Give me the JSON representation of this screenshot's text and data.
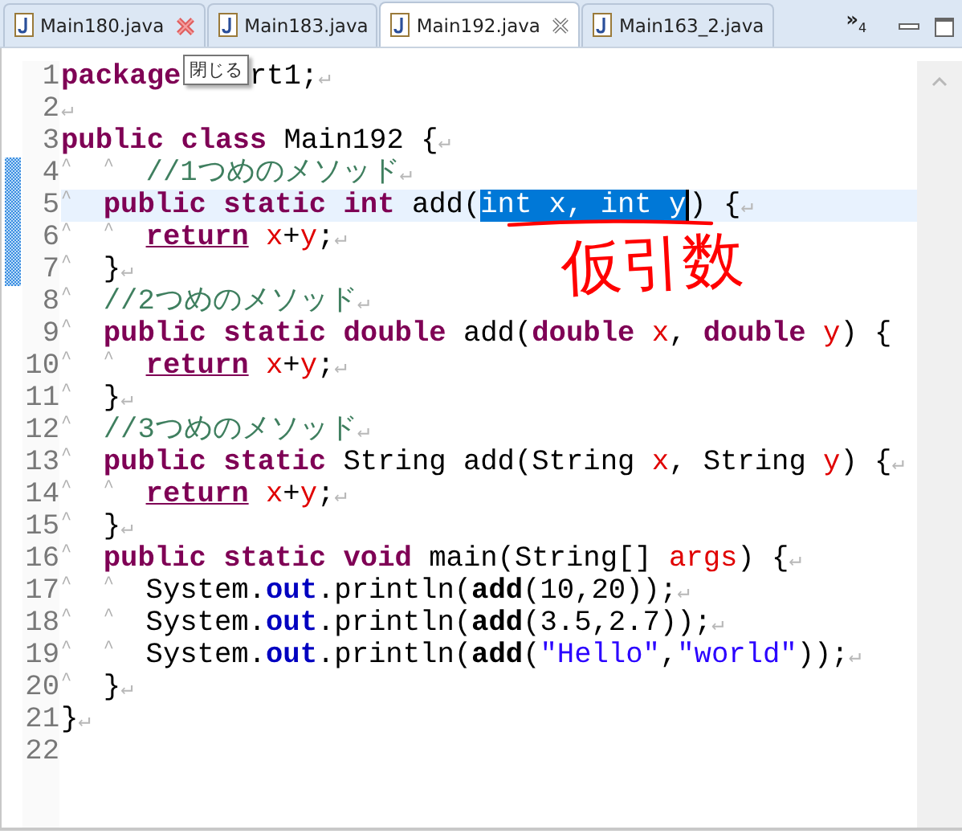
{
  "tabs": [
    {
      "label": "Main180.java",
      "selected": false,
      "closable": true,
      "close_hovered": true
    },
    {
      "label": "Main183.java",
      "selected": false,
      "closable": false
    },
    {
      "label": "Main192.java",
      "selected": true,
      "closable": true,
      "close_hovered": false
    },
    {
      "label": "Main163_2.java",
      "selected": false,
      "closable": false
    }
  ],
  "overflow": {
    "chevron": "»",
    "count": "4"
  },
  "tooltip": {
    "text": "閉じる"
  },
  "editor": {
    "lines": [
      {
        "number": "1",
        "current": false,
        "tokens": [
          {
            "kind": "kw",
            "text": "package"
          },
          {
            "kind": "gap"
          },
          {
            "kind": "plain",
            "text": "rt1;"
          },
          {
            "kind": "eol",
            "text": "↵"
          }
        ]
      },
      {
        "number": "2",
        "current": false,
        "tokens": [
          {
            "kind": "eol",
            "text": "↵"
          }
        ]
      },
      {
        "number": "3",
        "current": false,
        "tokens": [
          {
            "kind": "kw",
            "text": "public"
          },
          {
            "kind": "space"
          },
          {
            "kind": "kw",
            "text": "class"
          },
          {
            "kind": "space"
          },
          {
            "kind": "plain",
            "text": "Main192 {"
          },
          {
            "kind": "eol",
            "text": "↵"
          }
        ]
      },
      {
        "number": "4",
        "current": false,
        "tokens": [
          {
            "kind": "tab",
            "text": "^"
          },
          {
            "kind": "tab",
            "text": "^"
          },
          {
            "kind": "comment",
            "text": "//1つめのメソッド"
          },
          {
            "kind": "eol",
            "text": "↵"
          }
        ]
      },
      {
        "number": "5",
        "current": true,
        "tokens": [
          {
            "kind": "tab",
            "text": "^"
          },
          {
            "kind": "kw",
            "text": "public"
          },
          {
            "kind": "space"
          },
          {
            "kind": "kw",
            "text": "static"
          },
          {
            "kind": "space"
          },
          {
            "kind": "kw",
            "text": "int"
          },
          {
            "kind": "space"
          },
          {
            "kind": "plain",
            "text": "add("
          },
          {
            "kind": "sel",
            "text": "int x, int y"
          },
          {
            "kind": "caret"
          },
          {
            "kind": "plain",
            "text": ") {"
          },
          {
            "kind": "eol",
            "text": "↵"
          }
        ]
      },
      {
        "number": "6",
        "current": false,
        "tokens": [
          {
            "kind": "tab",
            "text": "^"
          },
          {
            "kind": "tab",
            "text": "^"
          },
          {
            "kind": "exit",
            "text": "return"
          },
          {
            "kind": "space"
          },
          {
            "kind": "var",
            "text": "x"
          },
          {
            "kind": "plain",
            "text": "+"
          },
          {
            "kind": "var",
            "text": "y"
          },
          {
            "kind": "plain",
            "text": ";"
          },
          {
            "kind": "eol",
            "text": "↵"
          }
        ]
      },
      {
        "number": "7",
        "current": false,
        "tokens": [
          {
            "kind": "tab",
            "text": "^"
          },
          {
            "kind": "plain",
            "text": "}"
          },
          {
            "kind": "eol",
            "text": "↵"
          }
        ]
      },
      {
        "number": "8",
        "current": false,
        "tokens": [
          {
            "kind": "tab",
            "text": "^"
          },
          {
            "kind": "comment",
            "text": "//2つめのメソッド"
          },
          {
            "kind": "eol",
            "text": "↵"
          }
        ]
      },
      {
        "number": "9",
        "current": false,
        "tokens": [
          {
            "kind": "tab",
            "text": "^"
          },
          {
            "kind": "kw",
            "text": "public"
          },
          {
            "kind": "space"
          },
          {
            "kind": "kw",
            "text": "static"
          },
          {
            "kind": "space"
          },
          {
            "kind": "kw",
            "text": "double"
          },
          {
            "kind": "space"
          },
          {
            "kind": "plain",
            "text": "add("
          },
          {
            "kind": "kw",
            "text": "double"
          },
          {
            "kind": "space"
          },
          {
            "kind": "var",
            "text": "x"
          },
          {
            "kind": "plain",
            "text": ","
          },
          {
            "kind": "space"
          },
          {
            "kind": "kw",
            "text": "double"
          },
          {
            "kind": "space"
          },
          {
            "kind": "var",
            "text": "y"
          },
          {
            "kind": "plain",
            "text": ") {"
          }
        ]
      },
      {
        "number": "10",
        "current": false,
        "tokens": [
          {
            "kind": "tab",
            "text": "^"
          },
          {
            "kind": "tab",
            "text": "^"
          },
          {
            "kind": "exit",
            "text": "return"
          },
          {
            "kind": "space"
          },
          {
            "kind": "var",
            "text": "x"
          },
          {
            "kind": "plain",
            "text": "+"
          },
          {
            "kind": "var",
            "text": "y"
          },
          {
            "kind": "plain",
            "text": ";"
          },
          {
            "kind": "eol",
            "text": "↵"
          }
        ]
      },
      {
        "number": "11",
        "current": false,
        "tokens": [
          {
            "kind": "tab",
            "text": "^"
          },
          {
            "kind": "plain",
            "text": "}"
          },
          {
            "kind": "eol",
            "text": "↵"
          }
        ]
      },
      {
        "number": "12",
        "current": false,
        "tokens": [
          {
            "kind": "tab",
            "text": "^"
          },
          {
            "kind": "comment",
            "text": "//3つめのメソッド"
          },
          {
            "kind": "eol",
            "text": "↵"
          }
        ]
      },
      {
        "number": "13",
        "current": false,
        "tokens": [
          {
            "kind": "tab",
            "text": "^"
          },
          {
            "kind": "kw",
            "text": "public"
          },
          {
            "kind": "space"
          },
          {
            "kind": "kw",
            "text": "static"
          },
          {
            "kind": "space"
          },
          {
            "kind": "plain",
            "text": "String add(String"
          },
          {
            "kind": "space"
          },
          {
            "kind": "var",
            "text": "x"
          },
          {
            "kind": "plain",
            "text": ", String"
          },
          {
            "kind": "space"
          },
          {
            "kind": "var",
            "text": "y"
          },
          {
            "kind": "plain",
            "text": ") {"
          },
          {
            "kind": "eol",
            "text": "↵"
          }
        ]
      },
      {
        "number": "14",
        "current": false,
        "tokens": [
          {
            "kind": "tab",
            "text": "^"
          },
          {
            "kind": "tab",
            "text": "^"
          },
          {
            "kind": "exit",
            "text": "return"
          },
          {
            "kind": "space"
          },
          {
            "kind": "var",
            "text": "x"
          },
          {
            "kind": "plain",
            "text": "+"
          },
          {
            "kind": "var",
            "text": "y"
          },
          {
            "kind": "plain",
            "text": ";"
          },
          {
            "kind": "eol",
            "text": "↵"
          }
        ]
      },
      {
        "number": "15",
        "current": false,
        "tokens": [
          {
            "kind": "tab",
            "text": "^"
          },
          {
            "kind": "plain",
            "text": "}"
          },
          {
            "kind": "eol",
            "text": "↵"
          }
        ]
      },
      {
        "number": "16",
        "current": false,
        "tokens": [
          {
            "kind": "tab",
            "text": "^"
          },
          {
            "kind": "kw",
            "text": "public"
          },
          {
            "kind": "space"
          },
          {
            "kind": "kw",
            "text": "static"
          },
          {
            "kind": "space"
          },
          {
            "kind": "kw",
            "text": "void"
          },
          {
            "kind": "space"
          },
          {
            "kind": "plain",
            "text": "main(String[]"
          },
          {
            "kind": "space"
          },
          {
            "kind": "var",
            "text": "args"
          },
          {
            "kind": "plain",
            "text": ") {"
          },
          {
            "kind": "eol",
            "text": "↵"
          }
        ]
      },
      {
        "number": "17",
        "current": false,
        "tokens": [
          {
            "kind": "tab",
            "text": "^"
          },
          {
            "kind": "tab",
            "text": "^"
          },
          {
            "kind": "plain",
            "text": "System."
          },
          {
            "kind": "field",
            "text": "out"
          },
          {
            "kind": "plain",
            "text": ".println("
          },
          {
            "kind": "method",
            "text": "add"
          },
          {
            "kind": "plain",
            "text": "(10,20));"
          },
          {
            "kind": "eol",
            "text": "↵"
          }
        ]
      },
      {
        "number": "18",
        "current": false,
        "tokens": [
          {
            "kind": "tab",
            "text": "^"
          },
          {
            "kind": "tab",
            "text": "^"
          },
          {
            "kind": "plain",
            "text": "System."
          },
          {
            "kind": "field",
            "text": "out"
          },
          {
            "kind": "plain",
            "text": ".println("
          },
          {
            "kind": "method",
            "text": "add"
          },
          {
            "kind": "plain",
            "text": "(3.5,2.7));"
          },
          {
            "kind": "eol",
            "text": "↵"
          }
        ]
      },
      {
        "number": "19",
        "current": false,
        "tokens": [
          {
            "kind": "tab",
            "text": "^"
          },
          {
            "kind": "tab",
            "text": "^"
          },
          {
            "kind": "plain",
            "text": "System."
          },
          {
            "kind": "field",
            "text": "out"
          },
          {
            "kind": "plain",
            "text": ".println("
          },
          {
            "kind": "method",
            "text": "add"
          },
          {
            "kind": "plain",
            "text": "("
          },
          {
            "kind": "string",
            "text": "\"Hello\""
          },
          {
            "kind": "plain",
            "text": ","
          },
          {
            "kind": "string",
            "text": "\"world\""
          },
          {
            "kind": "plain",
            "text": "));"
          },
          {
            "kind": "eol",
            "text": "↵"
          }
        ]
      },
      {
        "number": "20",
        "current": false,
        "tokens": [
          {
            "kind": "tab",
            "text": "^"
          },
          {
            "kind": "plain",
            "text": "}"
          },
          {
            "kind": "eol",
            "text": "↵"
          }
        ]
      },
      {
        "number": "21",
        "current": false,
        "tokens": [
          {
            "kind": "plain",
            "text": "}"
          },
          {
            "kind": "eol",
            "text": "↵"
          }
        ]
      },
      {
        "number": "22",
        "current": false
      }
    ]
  },
  "annotation": {
    "text": "仮引数"
  }
}
